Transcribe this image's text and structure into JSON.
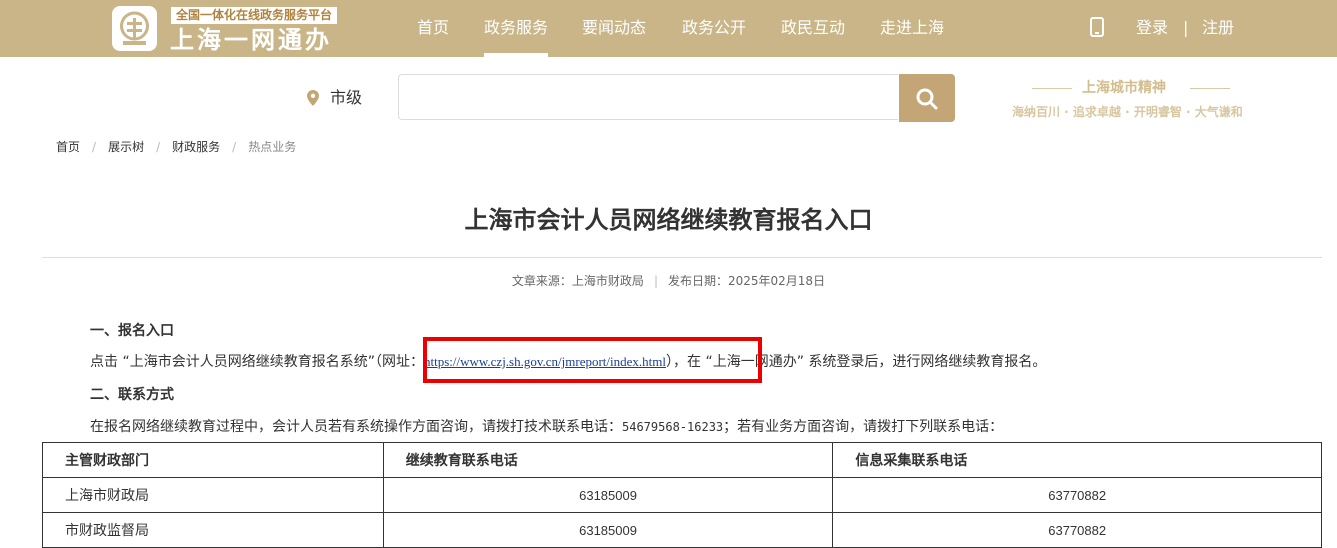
{
  "header": {
    "logo_tag": "全国一体化在线政务服务平台",
    "logo_name": "上海一网通办",
    "nav": [
      "首页",
      "政务服务",
      "要闻动态",
      "政务公开",
      "政民互动",
      "走进上海"
    ],
    "active_nav": "政务服务",
    "login": "登录",
    "separator": "|",
    "register": "注册",
    "bg_color": "#c9b587"
  },
  "search": {
    "location": "市级",
    "placeholder": "",
    "button_icon": "search-icon",
    "button_color": "#c4a676"
  },
  "spirit": {
    "title": "上海城市精神",
    "subtitle": "海纳百川 · 追求卓越 · 开明睿智 · 大气谦和"
  },
  "breadcrumb": [
    "首页",
    "展示树",
    "财政服务",
    "热点业务"
  ],
  "article": {
    "title": "上海市会计人员网络继续教育报名入口",
    "source": "文章来源：上海市财政局",
    "date": "发布日期：2025年02月18日",
    "section1_heading": "一、报名入口",
    "para1_prefix": "点击 “上海市会计人员网络继续教育报名系统”（网址：",
    "para1_link": "https://www.czj.sh.gov.cn/jmreport/index.html",
    "para1_suffix": "），在 “上海一网通办” 系统登录后，进行网络继续教育报名。",
    "section2_heading": "二、联系方式",
    "para2_prefix": "在报名网络继续教育过程中，会计人员若有系统操作方面咨询，请拨打技术联系电话：",
    "para2_phone": "54679568-16233",
    "para2_suffix": "；若有业务方面咨询，请拨打下列联系电话："
  },
  "table": {
    "headers": [
      "主管财政部门",
      "继续教育联系电话",
      "信息采集联系电话"
    ],
    "rows": [
      [
        "上海市财政局",
        "63185009",
        "63770882"
      ],
      [
        "市财政监督局",
        "63185009",
        "63770882"
      ]
    ]
  }
}
